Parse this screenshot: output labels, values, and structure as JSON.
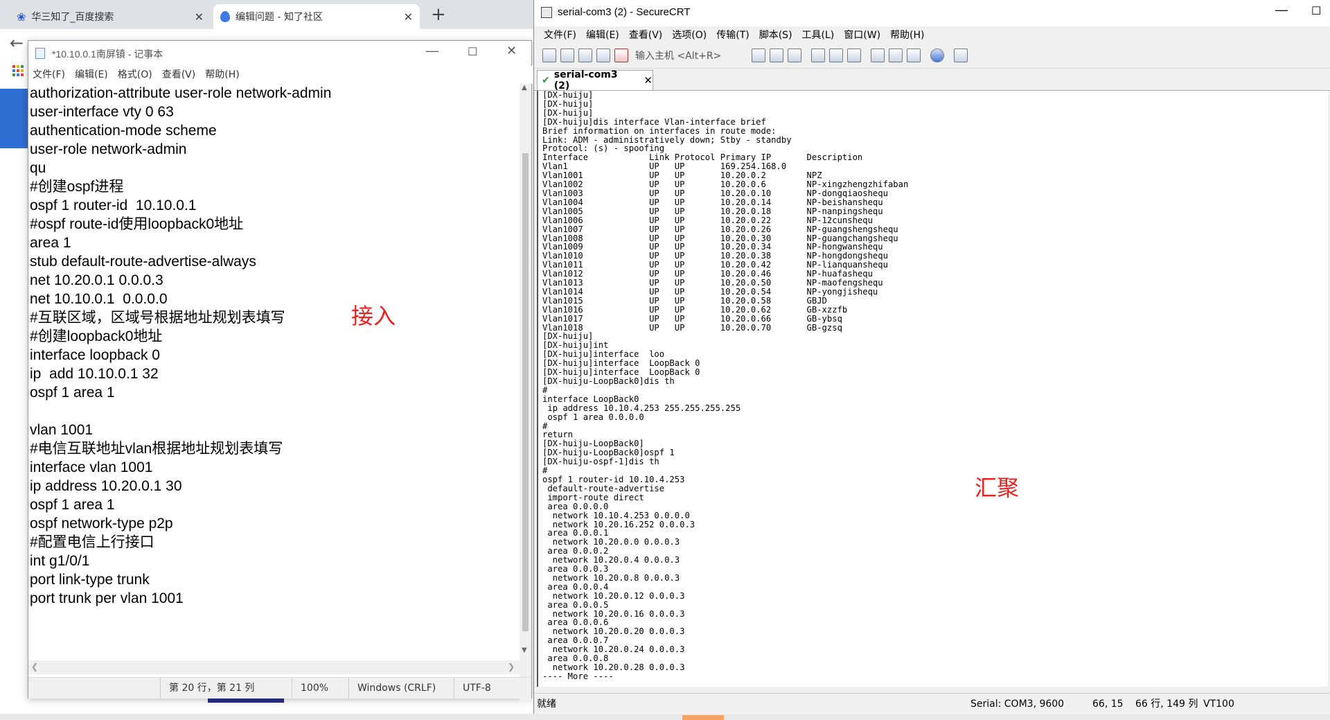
{
  "browser": {
    "tabs": [
      {
        "title": "华三知了_百度搜索",
        "active": false
      },
      {
        "title": "编辑问题 - 知了社区",
        "active": true
      }
    ],
    "new_tab_symbol": "+",
    "back_symbol": "←"
  },
  "notepad": {
    "title": "*10.10.0.1南屏镇 - 记事本",
    "menu": [
      "文件(F)",
      "编辑(E)",
      "格式(O)",
      "查看(V)",
      "帮助(H)"
    ],
    "lines": [
      "authorization-attribute user-role network-admin",
      "user-interface vty 0 63",
      "authentication-mode scheme",
      "user-role network-admin",
      "qu",
      "#创建ospf进程",
      "ospf 1 router-id  10.10.0.1",
      "#ospf route-id使用loopback0地址",
      "area 1",
      "stub default-route-advertise-always",
      "net 10.20.0.1 0.0.0.3",
      "net 10.10.0.1  0.0.0.0",
      "#互联区域，区域号根据地址规划表填写",
      "#创建loopback0地址",
      "interface loopback 0",
      "ip  add 10.10.0.1 32",
      "ospf 1 area 1",
      "",
      "vlan 1001",
      "#电信互联地址vlan根据地址规划表填写",
      "interface vlan 1001",
      "ip address 10.20.0.1 30",
      "ospf 1 area 1",
      "ospf network-type p2p",
      "#配置电信上行接口",
      "int g1/0/1",
      "port link-type trunk",
      "port trunk per vlan 1001"
    ],
    "annotation": "接入",
    "status": {
      "position": "第 20 行，第 21 列",
      "zoom": "100%",
      "eol": "Windows (CRLF)",
      "encoding": "UTF-8"
    }
  },
  "crt": {
    "title": "serial-com3 (2) - SecureCRT",
    "menu": [
      "文件(F)",
      "编辑(E)",
      "查看(V)",
      "选项(O)",
      "传输(T)",
      "脚本(S)",
      "工具(L)",
      "窗口(W)",
      "帮助(H)"
    ],
    "host_placeholder": "输入主机 <Alt+R>",
    "tab_label": "serial-com3 (2)",
    "terminal_lines": [
      "[DX-huiju]",
      "[DX-huiju]",
      "[DX-huiju]",
      "[DX-huiju]dis interface Vlan-interface brief",
      "Brief information on interfaces in route mode:",
      "Link: ADM - administratively down; Stby - standby",
      "Protocol: (s) - spoofing",
      "Interface            Link Protocol Primary IP       Description",
      "Vlan1                UP   UP       169.254.168.0",
      "Vlan1001             UP   UP       10.20.0.2        NPZ",
      "Vlan1002             UP   UP       10.20.0.6        NP-xingzhengzhifaban",
      "Vlan1003             UP   UP       10.20.0.10       NP-dongqiaoshequ",
      "Vlan1004             UP   UP       10.20.0.14       NP-beishanshequ",
      "Vlan1005             UP   UP       10.20.0.18       NP-nanpingshequ",
      "Vlan1006             UP   UP       10.20.0.22       NP-12cunshequ",
      "Vlan1007             UP   UP       10.20.0.26       NP-guangshengshequ",
      "Vlan1008             UP   UP       10.20.0.30       NP-guangchangshequ",
      "Vlan1009             UP   UP       10.20.0.34       NP-hongwanshequ",
      "Vlan1010             UP   UP       10.20.0.38       NP-hongdongshequ",
      "Vlan1011             UP   UP       10.20.0.42       NP-lianquanshequ",
      "Vlan1012             UP   UP       10.20.0.46       NP-huafashequ",
      "Vlan1013             UP   UP       10.20.0.50       NP-maofengshequ",
      "Vlan1014             UP   UP       10.20.0.54       NP-yongjishequ",
      "Vlan1015             UP   UP       10.20.0.58       GBJD",
      "Vlan1016             UP   UP       10.20.0.62       GB-xzzfb",
      "Vlan1017             UP   UP       10.20.0.66       GB-ybsq",
      "Vlan1018             UP   UP       10.20.0.70       GB-gzsq",
      "[DX-huiju]",
      "[DX-huiju]int",
      "[DX-huiju]interface  loo",
      "[DX-huiju]interface  LoopBack 0",
      "[DX-huiju]interface  LoopBack 0",
      "[DX-huiju-LoopBack0]dis th",
      "#",
      "interface LoopBack0",
      " ip address 10.10.4.253 255.255.255.255",
      " ospf 1 area 0.0.0.0",
      "#",
      "return",
      "[DX-huiju-LoopBack0]",
      "[DX-huiju-LoopBack0]ospf 1",
      "[DX-huiju-ospf-1]dis th",
      "#",
      "ospf 1 router-id 10.10.4.253",
      " default-route-advertise",
      " import-route direct",
      " area 0.0.0.0",
      "  network 10.10.4.253 0.0.0.0",
      "  network 10.20.16.252 0.0.0.3",
      " area 0.0.0.1",
      "  network 10.20.0.0 0.0.0.3",
      " area 0.0.0.2",
      "  network 10.20.0.4 0.0.0.3",
      " area 0.0.0.3",
      "  network 10.20.0.8 0.0.0.3",
      " area 0.0.0.4",
      "  network 10.20.0.12 0.0.0.3",
      " area 0.0.0.5",
      "  network 10.20.0.16 0.0.0.3",
      " area 0.0.0.6",
      "  network 10.20.0.20 0.0.0.3",
      " area 0.0.0.7",
      "  network 10.20.0.24 0.0.0.3",
      " area 0.0.0.8",
      "  network 10.20.0.28 0.0.0.3",
      "---- More ----"
    ],
    "annotation": "汇聚",
    "status": {
      "ready": "就绪",
      "serial": "Serial: COM3, 9600",
      "cursor": "66,  15",
      "rowscols": "66 行, 149 列",
      "term": "VT100"
    }
  }
}
